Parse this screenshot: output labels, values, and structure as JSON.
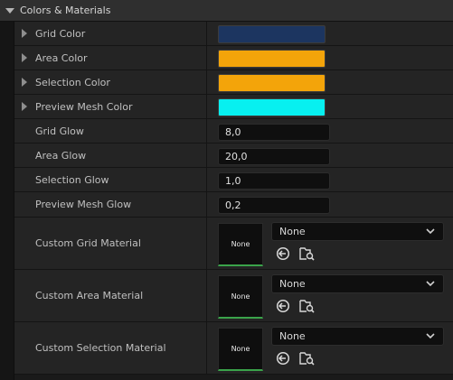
{
  "section": {
    "title": "Colors & Materials"
  },
  "color_rows": [
    {
      "label": "Grid Color",
      "color": "#1c3560"
    },
    {
      "label": "Area Color",
      "color": "#f3a40a"
    },
    {
      "label": "Selection Color",
      "color": "#f3a40a"
    },
    {
      "label": "Preview Mesh Color",
      "color": "#07f0f0"
    }
  ],
  "number_rows": [
    {
      "label": "Grid Glow",
      "value": "8,0"
    },
    {
      "label": "Area Glow",
      "value": "20,0"
    },
    {
      "label": "Selection Glow",
      "value": "1,0"
    },
    {
      "label": "Preview Mesh Glow",
      "value": "0,2"
    }
  ],
  "material_rows": [
    {
      "label": "Custom Grid Material",
      "thumbnail_text": "None",
      "selected": "None"
    },
    {
      "label": "Custom Area Material",
      "thumbnail_text": "None",
      "selected": "None"
    },
    {
      "label": "Custom Selection Material",
      "thumbnail_text": "None",
      "selected": "None"
    }
  ],
  "icons": {
    "section_toggle": "triangle-down-icon",
    "row_expander": "triangle-right-icon",
    "dropdown": "chevron-down-icon",
    "use_selected": "use-selected-arrow-icon",
    "browse": "browse-folder-icon"
  },
  "colors": {
    "thumbnail_underline": "#3aa34a"
  }
}
